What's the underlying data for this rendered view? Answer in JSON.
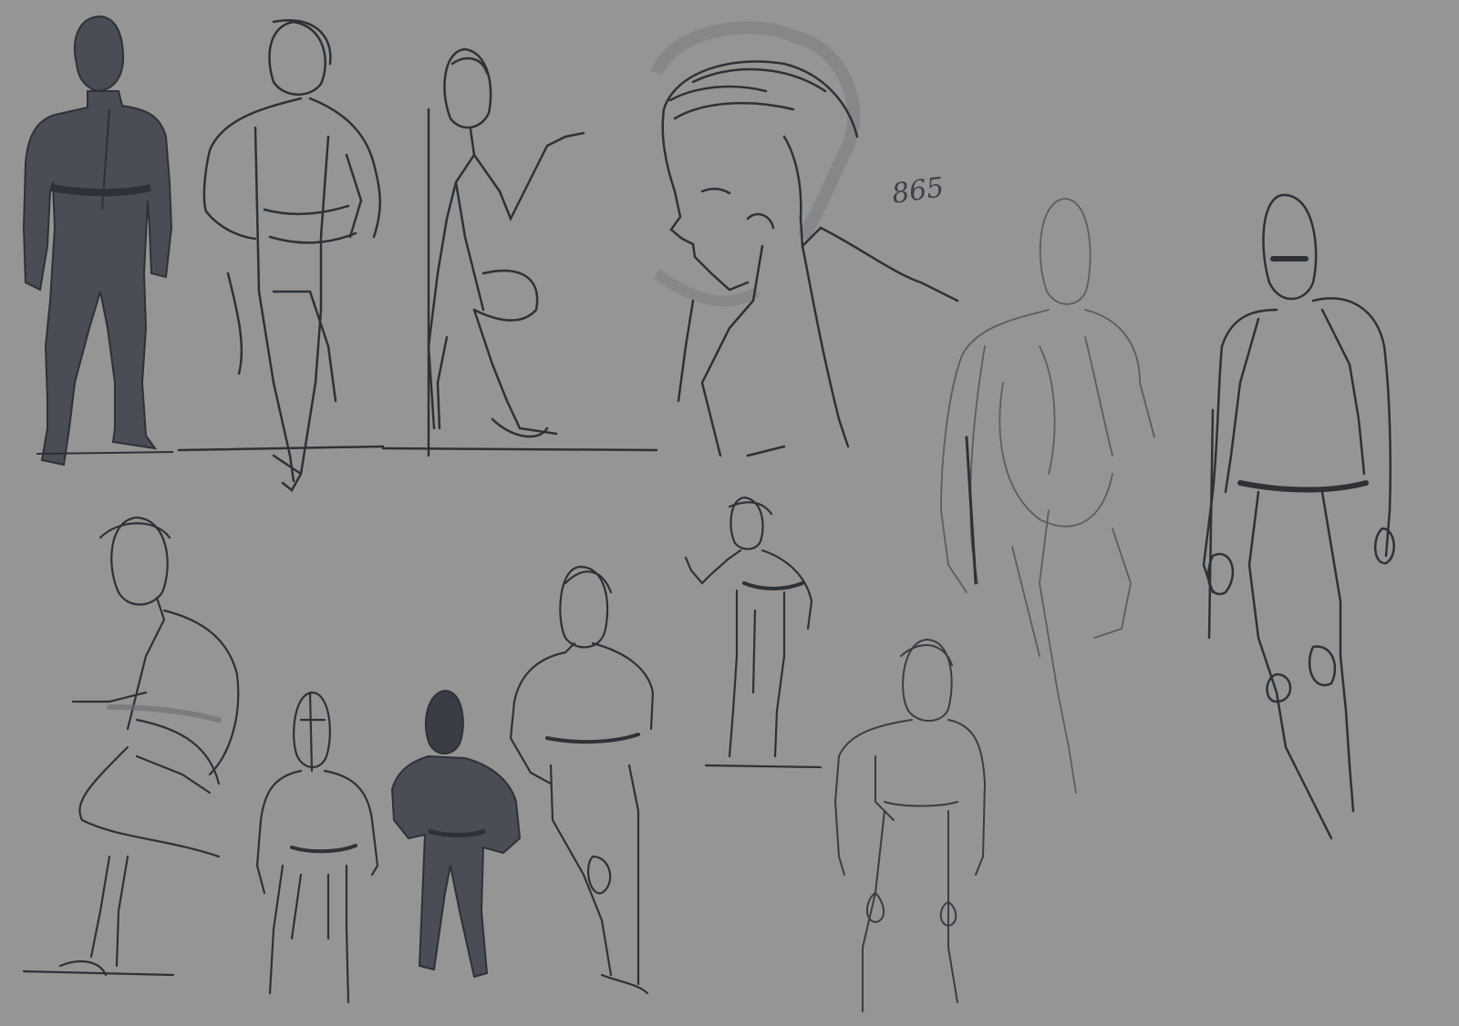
{
  "artwork": {
    "kind": "character sketch sheet",
    "background_color": "#959595",
    "ink_color": "#2e3136",
    "fill_color": "#4a4d55",
    "light_line_color": "#5a5d63",
    "annotation_text": "865",
    "figures": [
      {
        "id": "standing-filled-1",
        "style": "filled silhouette"
      },
      {
        "id": "hooded-walking",
        "style": "dark line sketch"
      },
      {
        "id": "side-pointing",
        "style": "dark line sketch"
      },
      {
        "id": "portrait-bust",
        "style": "detailed line sketch"
      },
      {
        "id": "rear-view-light",
        "style": "light construction sketch"
      },
      {
        "id": "tall-coat-figure",
        "style": "dark line sketch"
      },
      {
        "id": "crouching-figure",
        "style": "line sketch"
      },
      {
        "id": "front-view-small",
        "style": "line sketch"
      },
      {
        "id": "caped-figure-filled",
        "style": "filled silhouette"
      },
      {
        "id": "hand-on-hip-figure",
        "style": "line sketch"
      },
      {
        "id": "small-gesturing-figure",
        "style": "dark line sketch"
      },
      {
        "id": "front-view-medium",
        "style": "line sketch"
      }
    ]
  }
}
